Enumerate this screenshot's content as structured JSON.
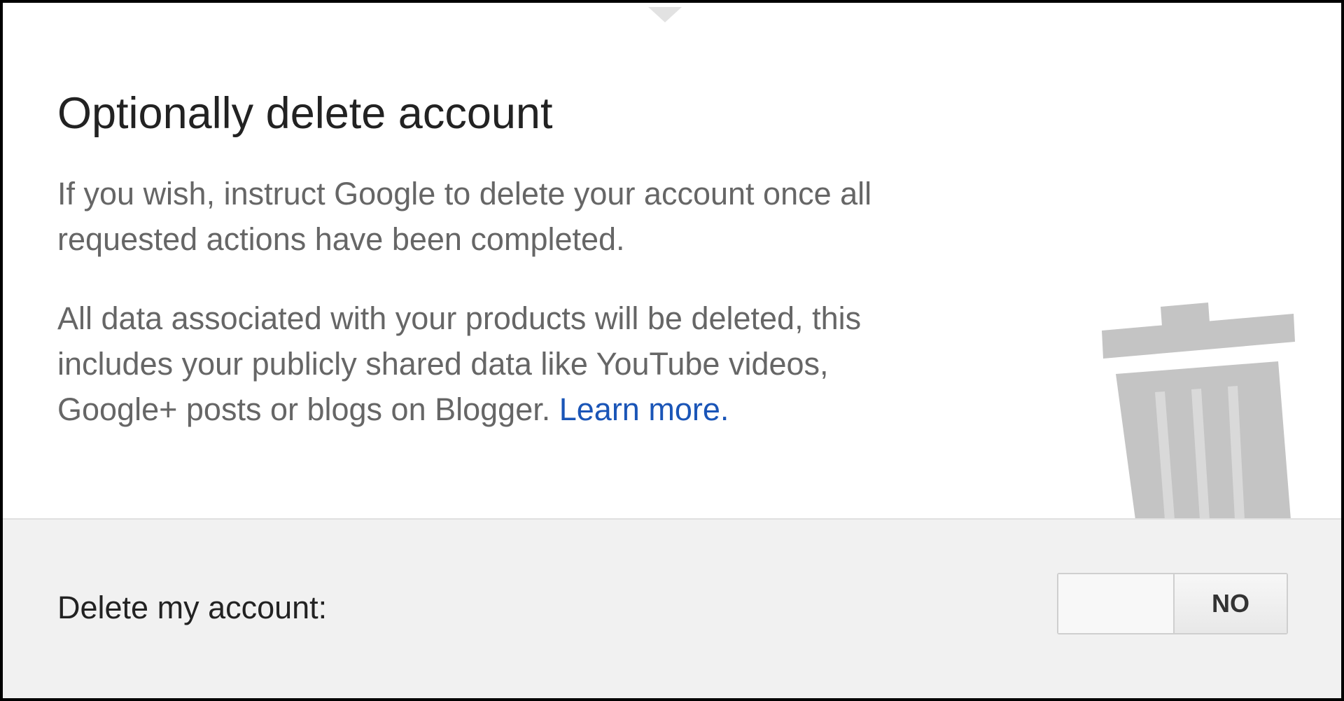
{
  "dialog": {
    "title": "Optionally delete account",
    "paragraph_1_line_1": "If you wish, instruct Google to delete your account once all",
    "paragraph_1_line_2": "requested actions have been completed.",
    "paragraph_2_line_1": "All data associated with your products will be deleted, this",
    "paragraph_2_line_2": "includes your publicly shared data like YouTube videos,",
    "paragraph_2_line_3_prefix": "Google+ posts or blogs on Blogger. ",
    "learn_more_label": "Learn more",
    "learn_more_suffix": ".",
    "illustration_icon": "trash-can-icon"
  },
  "footer": {
    "label": "Delete my account:",
    "toggle": {
      "state_label": "NO",
      "checked": false
    }
  },
  "colors": {
    "link": "#1a55b7",
    "body_text": "#666666",
    "heading_text": "#222222",
    "footer_background": "#f1f1f1",
    "icon_gray": "#c4c4c4"
  }
}
